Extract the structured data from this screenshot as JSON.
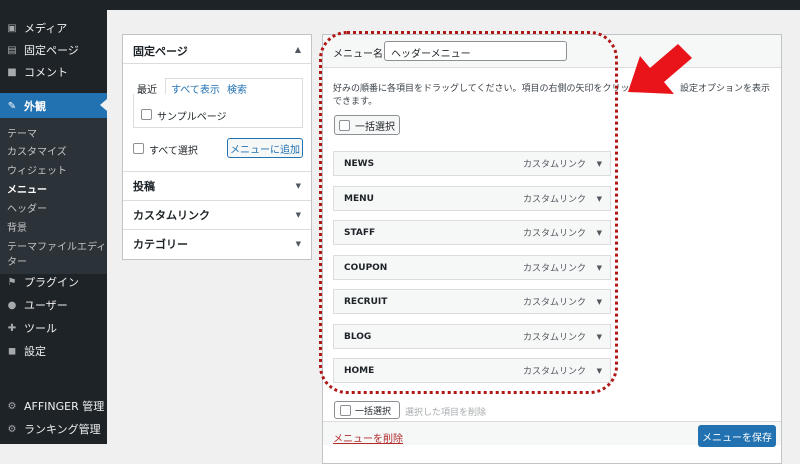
{
  "sidebar": {
    "top_items": [
      {
        "label": "メディア",
        "icon": "media-icon"
      },
      {
        "label": "固定ページ",
        "icon": "pages-icon"
      },
      {
        "label": "コメント",
        "icon": "comments-icon"
      },
      {
        "label": "外観",
        "icon": "appearance-icon"
      }
    ],
    "submenu": [
      "テーマ",
      "カスタマイズ",
      "ウィジェット",
      "メニュー",
      "ヘッダー",
      "背景",
      "テーマファイルエディ",
      "ター"
    ],
    "bottom_items": [
      {
        "label": "プラグイン",
        "icon": "plugins-icon"
      },
      {
        "label": "ユーザー",
        "icon": "users-icon"
      },
      {
        "label": "ツール",
        "icon": "tools-icon"
      },
      {
        "label": "設定",
        "icon": "settings-icon"
      },
      {
        "label": "AFFINGER 管理",
        "icon": "gear-icon"
      },
      {
        "label": "ランキング管理",
        "icon": "gear-icon"
      }
    ]
  },
  "left_panel": {
    "pages_title": "固定ページ",
    "tabs": [
      "最近",
      "すべて表示",
      "検索"
    ],
    "sample_page": "サンプルページ",
    "select_all": "すべて選択",
    "add_button": "メニューに追加",
    "sections": [
      "投稿",
      "カスタムリンク",
      "カテゴリー"
    ]
  },
  "menu_editor": {
    "name_label": "メニュー名",
    "name_value": "ヘッダーメニュー",
    "instructions_line1": "好みの順番に各項目をドラッグしてください。項目の右側の矢印をクリックす",
    "instructions_line1_end": "設定オプションを表示",
    "instructions_line2": "できます。",
    "bulk_select": "一括選択",
    "items": [
      {
        "name": "NEWS",
        "type": "カスタムリンク"
      },
      {
        "name": "MENU",
        "type": "カスタムリンク"
      },
      {
        "name": "STAFF",
        "type": "カスタムリンク"
      },
      {
        "name": "COUPON",
        "type": "カスタムリンク"
      },
      {
        "name": "RECRUIT",
        "type": "カスタムリンク"
      },
      {
        "name": "BLOG",
        "type": "カスタムリンク"
      },
      {
        "name": "HOME",
        "type": "カスタムリンク"
      }
    ],
    "bulk_select_bottom": "一括選択",
    "remove_selected": "選択した項目を削除",
    "delete_menu": "メニューを削除",
    "save_menu": "メニューを保存"
  },
  "colors": {
    "annotation": "#b01818",
    "arrow": "#e8141a",
    "accent": "#2271b1"
  }
}
